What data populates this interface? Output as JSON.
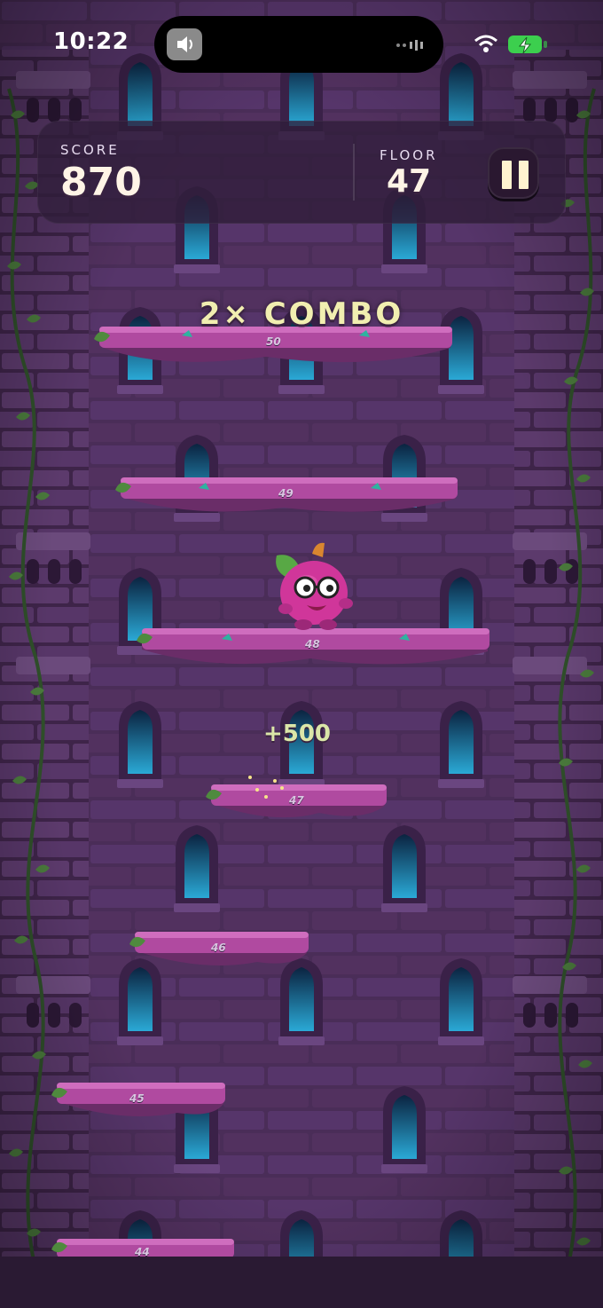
{
  "status_bar": {
    "time": "10:22"
  },
  "hud": {
    "score_label": "SCORE",
    "score_value": "870",
    "floor_label": "FLOOR",
    "floor_value": "47"
  },
  "combo_text": "2× COMBO",
  "score_popup": "+500",
  "platforms": [
    {
      "number": "50"
    },
    {
      "number": "49"
    },
    {
      "number": "48"
    },
    {
      "number": "47"
    },
    {
      "number": "46"
    },
    {
      "number": "45"
    },
    {
      "number": "44"
    }
  ],
  "colors": {
    "tower_wall": "#4a2d58",
    "platform": "#b04aa0",
    "vine": "#3e6a34",
    "window_glow": "#2aa9d6",
    "hud_text": "#fff4e6"
  }
}
